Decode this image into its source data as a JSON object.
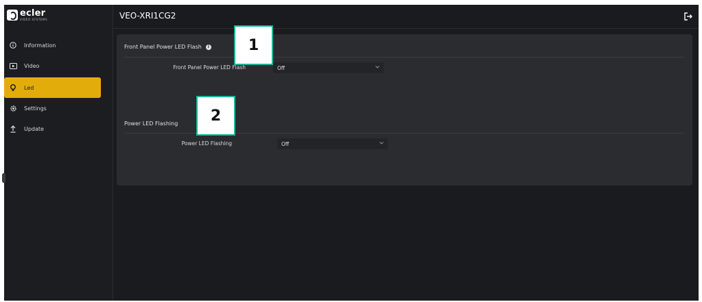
{
  "brand": {
    "word": "ecler",
    "sub": "VIDEO SYSTEMS"
  },
  "header": {
    "title": "VEO-XRI1CG2",
    "logout_icon": "logout-icon"
  },
  "sidebar": {
    "items": [
      {
        "label": "Information",
        "icon": "info-circle-icon"
      },
      {
        "label": "Video",
        "icon": "video-icon"
      },
      {
        "label": "Led",
        "icon": "bulb-icon",
        "active": true
      },
      {
        "label": "Settings",
        "icon": "gear-icon"
      },
      {
        "label": "Update",
        "icon": "upload-icon"
      }
    ]
  },
  "sections": [
    {
      "title": "Front Panel Power LED Flash",
      "field_label": "Front Panel Power LED Flash",
      "value": "Off"
    },
    {
      "title": "Power LED Flashing",
      "field_label": "Power LED Flashing",
      "value": "Off"
    }
  ],
  "callouts": [
    "1",
    "2"
  ],
  "colors": {
    "accent": "#e2ad0b",
    "callout_border": "#19b89a",
    "background": "#1a1b1f",
    "panel": "#2b2c30"
  }
}
